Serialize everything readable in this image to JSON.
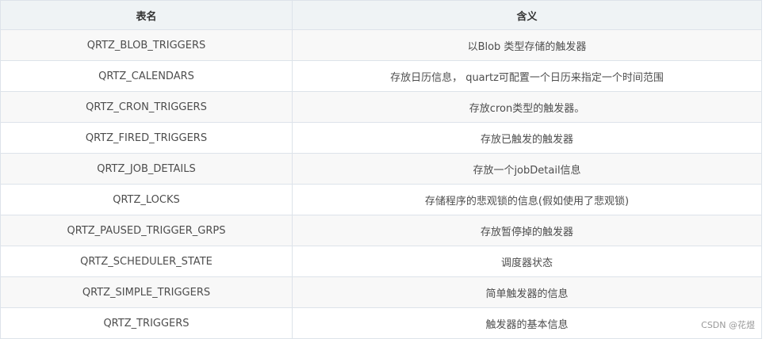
{
  "table": {
    "headers": [
      "表名",
      "含义"
    ],
    "rows": [
      [
        "QRTZ_BLOB_TRIGGERS",
        "以Blob 类型存储的触发器"
      ],
      [
        "QRTZ_CALENDARS",
        "存放日历信息， quartz可配置一个日历来指定一个时间范围"
      ],
      [
        "QRTZ_CRON_TRIGGERS",
        "存放cron类型的触发器。"
      ],
      [
        "QRTZ_FIRED_TRIGGERS",
        "存放已触发的触发器"
      ],
      [
        "QRTZ_JOB_DETAILS",
        "存放一个jobDetail信息"
      ],
      [
        "QRTZ_LOCKS",
        "存储程序的悲观锁的信息(假如使用了悲观锁)"
      ],
      [
        "QRTZ_PAUSED_TRIGGER_GRPS",
        "存放暂停掉的触发器"
      ],
      [
        "QRTZ_SCHEDULER_STATE",
        "调度器状态"
      ],
      [
        "QRTZ_SIMPLE_TRIGGERS",
        "简单触发器的信息"
      ],
      [
        "QRTZ_TRIGGERS",
        "触发器的基本信息"
      ]
    ]
  },
  "watermark": "CSDN @花煜"
}
